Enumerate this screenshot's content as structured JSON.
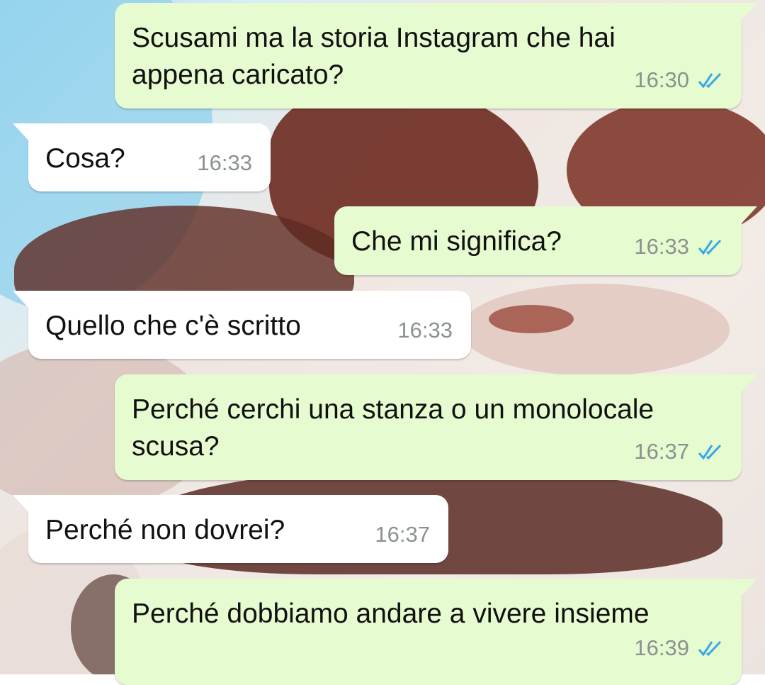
{
  "colors": {
    "outgoing_bubble": "#e7fbd0",
    "incoming_bubble": "#ffffff",
    "timestamp": "#8a9290",
    "read_ticks": "#39a7e6"
  },
  "messages": [
    {
      "direction": "out",
      "lines": [
        "Scusami ma la storia Instagram che hai",
        "appena caricato?"
      ],
      "time": "16:30",
      "status": "read",
      "status_icon": "double-check-icon"
    },
    {
      "direction": "in",
      "lines": [
        "Cosa?"
      ],
      "time": "16:33"
    },
    {
      "direction": "out",
      "lines": [
        "Che mi significa?"
      ],
      "time": "16:33",
      "status": "read",
      "status_icon": "double-check-icon"
    },
    {
      "direction": "in",
      "lines": [
        "Quello che c'è scritto"
      ],
      "time": "16:33"
    },
    {
      "direction": "out",
      "lines": [
        "Perché cerchi una stanza o un monolocale",
        "scusa?"
      ],
      "time": "16:37",
      "status": "read",
      "status_icon": "double-check-icon"
    },
    {
      "direction": "in",
      "lines": [
        "Perché non dovrei?"
      ],
      "time": "16:37"
    },
    {
      "direction": "out",
      "lines": [
        "Perché dobbiamo andare a vivere insieme"
      ],
      "time": "16:39",
      "status": "read",
      "status_icon": "double-check-icon"
    }
  ]
}
